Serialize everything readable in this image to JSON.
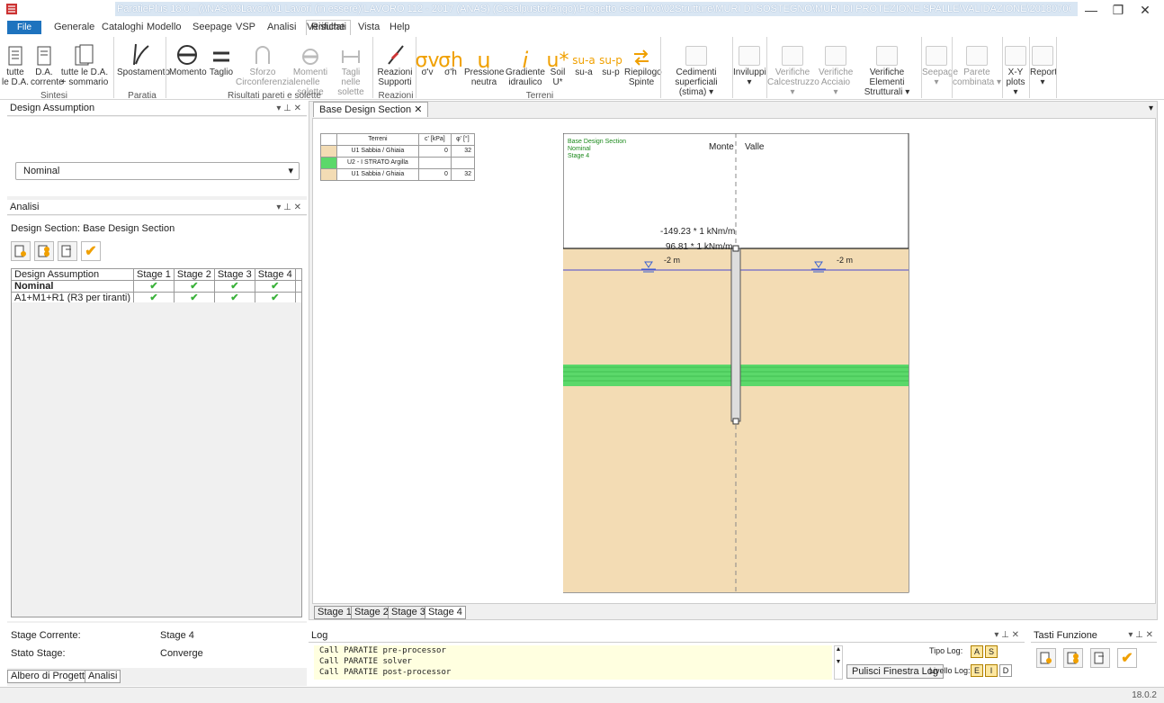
{
  "window": {
    "title": "ParatiePlus 18.0 - (\\\\NAS\\03Lavori\\01 Lavori (in essere)\\LAVORO 112 - 2017 (ANAS) (Casalpusterlengo)\\Progetto esecutivo\\02Strutture\\MURI DI SOSTEGNO\\MURI DI PROTEZIONE SPALLE\\VALIDAZIONE\\20180706 SS9 - MODELLO 1.pplus) New Project *",
    "minimize": "—",
    "restore": "❐",
    "close": "✕"
  },
  "menu": {
    "file": "File",
    "items": [
      "Generale",
      "Cataloghi",
      "Modello",
      "Seepage",
      "VSP",
      "Analisi",
      "Verifiche",
      "Risultati",
      "Vista",
      "Help"
    ]
  },
  "ribbon": {
    "sintesi": {
      "b1": "tutte le D.A.",
      "b2": "D.A. corrente",
      "b3": "tutte le D.A. + sommario",
      "group": "Sintesi"
    },
    "paratia": {
      "b1": "Spostamento",
      "group": "Paratia"
    },
    "pareti": {
      "b1": "Momento",
      "b2": "Taglio",
      "b3": "Sforzo Circonferenziale",
      "b4": "Momenti nelle solette",
      "b5": "Tagli nelle solette",
      "group": "Risultati pareti e solette"
    },
    "reazioni": {
      "b1": "Reazioni Supporti",
      "group": "Reazioni"
    },
    "terreni": {
      "b1": "σ'v",
      "b2": "σ'h",
      "b3": "Pressione neutra",
      "b4": "Gradiente idraulico",
      "b5": "Soil U*",
      "b6": "su-a",
      "b7": "su-p",
      "b8": "Riepilogo Spinte",
      "group": "Terreni",
      "sym1": "σv",
      "sym2": "σh",
      "sym3": "u",
      "sym4": "i",
      "sym5": "u*",
      "sym6": "su-a",
      "sym7": "su-p"
    },
    "other": [
      "Cedimenti superficiali (stima) ▾",
      "Inviluppi ▾",
      "Verifiche Calcestruzzo ▾",
      "Verifiche Acciaio ▾",
      "Verifiche Elementi Strutturali ▾",
      "Seepage ▾",
      "Parete combinata ▾",
      "X-Y plots ▾",
      "Report ▾"
    ]
  },
  "design_assumption_panel": {
    "title": "Design Assumption",
    "selected": "Nominal"
  },
  "analisi_panel": {
    "title": "Analisi",
    "design_section": "Design Section:  Base Design Section",
    "table": {
      "headers": [
        "Design Assumption",
        "Stage 1",
        "Stage 2",
        "Stage 3",
        "Stage 4"
      ],
      "rows": [
        {
          "name": "Nominal",
          "checks": [
            "✔",
            "✔",
            "✔",
            "✔"
          ]
        },
        {
          "name": "A1+M1+R1 (R3 per tiranti)",
          "checks": [
            "✔",
            "✔",
            "✔",
            "✔"
          ]
        }
      ]
    },
    "stage_corrente_label": "Stage Corrente:",
    "stage_corrente": "Stage 4",
    "stato_stage_label": "Stato Stage:",
    "stato_stage": "Converge"
  },
  "left_tabs": [
    "Albero di Progetto",
    "Analisi"
  ],
  "document": {
    "tab": "Base Design Section",
    "stage_tabs": [
      "Stage 1",
      "Stage 2",
      "Stage 3",
      "Stage 4"
    ]
  },
  "legend": {
    "headers": [
      "Terreni",
      "c' [kPa]",
      "φ' [°]"
    ],
    "rows": [
      {
        "name": "U1 Sabbia / Ghiaia",
        "c": "0",
        "phi": "32"
      },
      {
        "name": "U2 - I STRATO Argilla",
        "c": "",
        "phi": ""
      },
      {
        "name": "U1 Sabbia / Ghiaia",
        "c": "0",
        "phi": "32"
      }
    ]
  },
  "drawing": {
    "info_l1": "Base Design Section",
    "info_l2": "Nominal",
    "info_l3": "Stage 4",
    "monte": "Monte",
    "valle": "Valle",
    "label_a": "-149.23 * 1 kNm/m",
    "label_b": "96.81 * 1 kNm/m",
    "water_left": "-2 m",
    "water_right": "-2 m",
    "colors": {
      "sand": "#f3dcb4",
      "green": "#5bd86a",
      "info": "#1c8a1c"
    }
  },
  "log": {
    "title": "Log",
    "lines": [
      "Call PARATIE pre-processor",
      "Call PARATIE solver",
      "Call PARATIE post-processor"
    ],
    "clear": "Pulisci Finestra Log",
    "tipo": "Tipo Log:",
    "livello": "Livello Log:",
    "tipo_btns": [
      "A",
      "S"
    ],
    "livello_btns": [
      "E",
      "I",
      "D"
    ]
  },
  "fkeys": {
    "title": "Tasti Funzione"
  },
  "status": {
    "version": "18.0.2"
  }
}
